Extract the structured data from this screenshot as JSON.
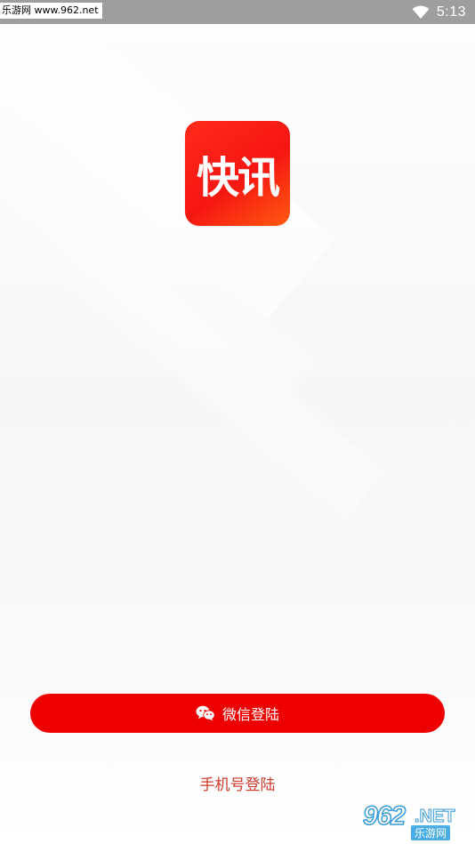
{
  "status_bar": {
    "watermark_text": "乐游网 www.962.net",
    "time": "5:13",
    "wifi_icon": "wifi-icon"
  },
  "logo": {
    "text": "快讯",
    "color_start": "#ff2a1a",
    "color_end": "#ff5a10"
  },
  "login": {
    "wechat_label": "微信登陆",
    "wechat_icon": "wechat-icon",
    "phone_label": "手机号登陆",
    "primary_color": "#ee0000",
    "link_color": "#cc3b2e"
  },
  "watermark_bottom": {
    "number": "962",
    "domain": ".NET",
    "site_name": "乐游网"
  }
}
